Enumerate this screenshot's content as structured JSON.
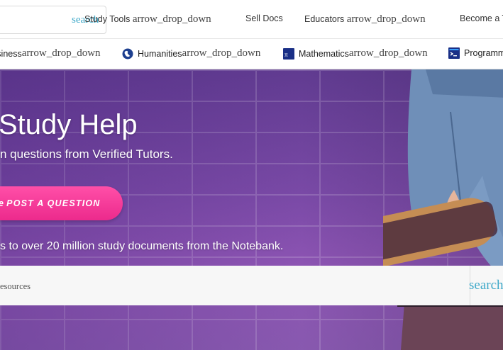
{
  "header": {
    "search_button_text": "search",
    "nav": [
      {
        "label": "Study Tools ",
        "ligature": "arrow_drop_down"
      },
      {
        "label": "Sell Docs",
        "ligature": ""
      },
      {
        "label": "Educators ",
        "ligature": "arrow_drop_down"
      },
      {
        "label": "Become a T",
        "ligature": ""
      }
    ]
  },
  "categories": [
    {
      "label": "Business",
      "ligature": "arrow_drop_down",
      "icon": "business-icon"
    },
    {
      "label": "Humanities",
      "ligature": "arrow_drop_down",
      "icon": "globe-icon"
    },
    {
      "label": "Mathematics",
      "ligature": "arrow_drop_down",
      "icon": "math-icon"
    },
    {
      "label": "Programm",
      "ligature": "",
      "icon": "terminal-icon"
    }
  ],
  "hero": {
    "title": "Study Help",
    "subtitle": "n questions from Verified Tutors.",
    "cta_prefix": "e",
    "cta_label": "POST A QUESTION",
    "note": "s to over 20 million study documents from the Notebank.",
    "resource_placeholder": "esources",
    "resource_search_text": "search"
  },
  "colors": {
    "accent_blue": "#3fa9c9",
    "cta_pink": "#ec2a8c",
    "hero_purple": "#7a4aa6"
  }
}
